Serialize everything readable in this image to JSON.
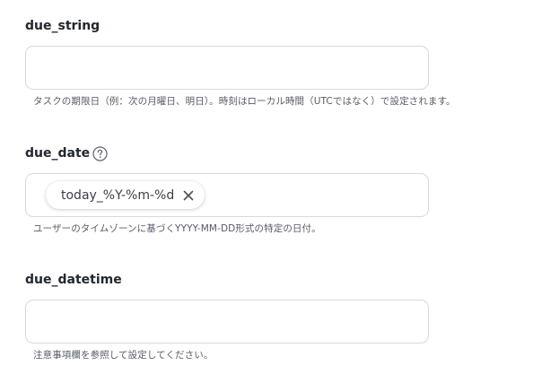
{
  "fields": [
    {
      "label": "due_string",
      "value": "",
      "description": "タスクの期限日（例：次の月曜日、明日）。時刻はローカル時間（UTCではなく）で設定されます。",
      "has_help_icon": false
    },
    {
      "label": "due_date",
      "value": "",
      "chip_text": "today_%Y-%m-%d",
      "description": "ユーザーのタイムゾーンに基づくYYYY-MM-DD形式の特定の日付。",
      "has_help_icon": true
    },
    {
      "label": "due_datetime",
      "value": "",
      "description": "注意事項欄を参照して設定してください。",
      "has_help_icon": false
    }
  ],
  "icons": {
    "help": "help-circle-icon",
    "chip_remove": "close-icon"
  },
  "colors": {
    "border": "#d8d9dd",
    "label": "#23272e",
    "description": "#555b66"
  }
}
